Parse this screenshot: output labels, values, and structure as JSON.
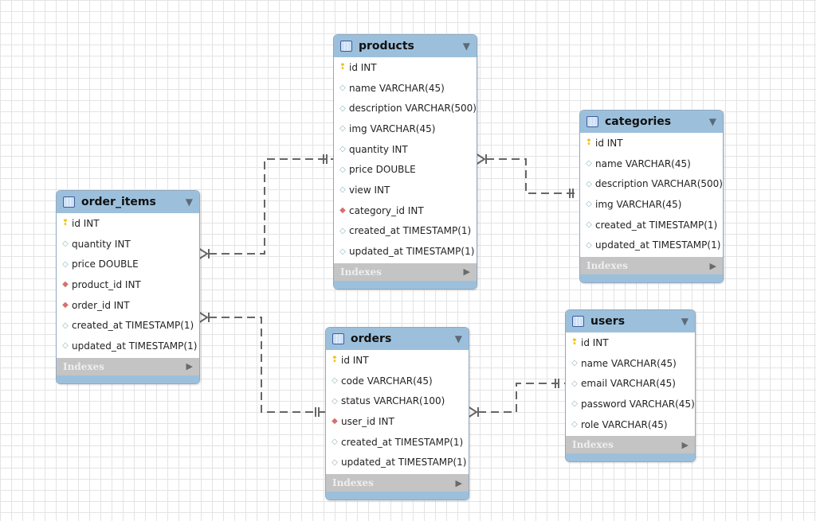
{
  "tables": {
    "products": {
      "name": "products",
      "columns": [
        {
          "text": "id INT",
          "kind": "pk"
        },
        {
          "text": "name VARCHAR(45)",
          "kind": "col"
        },
        {
          "text": "description VARCHAR(500)",
          "kind": "col"
        },
        {
          "text": "img VARCHAR(45)",
          "kind": "col"
        },
        {
          "text": "quantity INT",
          "kind": "col"
        },
        {
          "text": "price DOUBLE",
          "kind": "col"
        },
        {
          "text": "view INT",
          "kind": "col"
        },
        {
          "text": "category_id INT",
          "kind": "fk"
        },
        {
          "text": "created_at TIMESTAMP(1)",
          "kind": "col"
        },
        {
          "text": "updated_at TIMESTAMP(1)",
          "kind": "col"
        }
      ],
      "indexes": "Indexes"
    },
    "categories": {
      "name": "categories",
      "columns": [
        {
          "text": "id INT",
          "kind": "pk"
        },
        {
          "text": "name VARCHAR(45)",
          "kind": "col"
        },
        {
          "text": "description VARCHAR(500)",
          "kind": "col"
        },
        {
          "text": "img VARCHAR(45)",
          "kind": "col"
        },
        {
          "text": "created_at TIMESTAMP(1)",
          "kind": "col"
        },
        {
          "text": "updated_at TIMESTAMP(1)",
          "kind": "col"
        }
      ],
      "indexes": "Indexes"
    },
    "order_items": {
      "name": "order_items",
      "columns": [
        {
          "text": "id INT",
          "kind": "pk"
        },
        {
          "text": "quantity INT",
          "kind": "col"
        },
        {
          "text": "price DOUBLE",
          "kind": "col"
        },
        {
          "text": "product_id INT",
          "kind": "fk"
        },
        {
          "text": "order_id INT",
          "kind": "fk"
        },
        {
          "text": "created_at TIMESTAMP(1)",
          "kind": "col"
        },
        {
          "text": "updated_at TIMESTAMP(1)",
          "kind": "col"
        }
      ],
      "indexes": "Indexes"
    },
    "orders": {
      "name": "orders",
      "columns": [
        {
          "text": "id INT",
          "kind": "pk"
        },
        {
          "text": "code VARCHAR(45)",
          "kind": "col"
        },
        {
          "text": "status VARCHAR(100)",
          "kind": "col"
        },
        {
          "text": "user_id INT",
          "kind": "fk"
        },
        {
          "text": "created_at TIMESTAMP(1)",
          "kind": "col"
        },
        {
          "text": "updated_at TIMESTAMP(1)",
          "kind": "col"
        }
      ],
      "indexes": "Indexes"
    },
    "users": {
      "name": "users",
      "columns": [
        {
          "text": "id INT",
          "kind": "pk"
        },
        {
          "text": "name VARCHAR(45)",
          "kind": "col"
        },
        {
          "text": "email VARCHAR(45)",
          "kind": "col"
        },
        {
          "text": "password VARCHAR(45)",
          "kind": "col"
        },
        {
          "text": "role VARCHAR(45)",
          "kind": "col"
        }
      ],
      "indexes": "Indexes"
    }
  },
  "relationships": [
    {
      "from": "order_items",
      "to": "products",
      "type": "many-to-one"
    },
    {
      "from": "products",
      "to": "categories",
      "type": "many-to-one"
    },
    {
      "from": "order_items",
      "to": "orders",
      "type": "many-to-one"
    },
    {
      "from": "orders",
      "to": "users",
      "type": "many-to-one"
    }
  ],
  "icons": {
    "pk": "key-icon",
    "fk": "foreign-key-diamond-icon",
    "col": "column-diamond-icon"
  },
  "colors": {
    "header": "#9cc0dc",
    "indexes": "#c4c4c4",
    "pk": "#f0c419",
    "fk": "#d57070"
  }
}
